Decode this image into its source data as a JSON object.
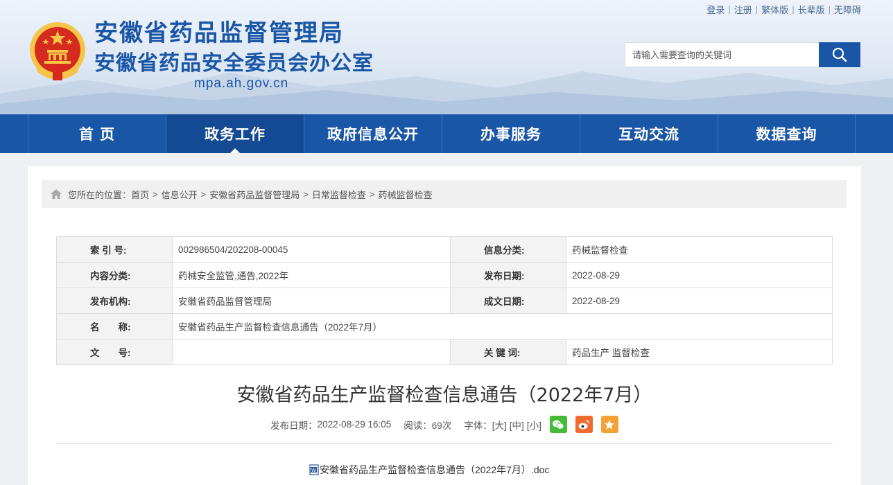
{
  "header": {
    "title": "安徽省药品监督管理局",
    "subtitle": "安徽省药品安全委员会办公室",
    "domain": "mpa.ah.gov.cn",
    "top_links": [
      "登录",
      "注册",
      "繁体版",
      "长辈版",
      "无障碍"
    ],
    "search": {
      "placeholder": "请输入需要查询的关键词",
      "icon": "search-icon"
    }
  },
  "nav": {
    "items": [
      "首 页",
      "政务工作",
      "政府信息公开",
      "办事服务",
      "互动交流",
      "数据查询"
    ],
    "active": "政务工作"
  },
  "breadcrumb": {
    "prefix": "您所在的位置：",
    "items": [
      "首页",
      "信息公开",
      "安徽省药品监督管理局",
      "日常监督检查",
      "药械监督检查"
    ],
    "separator": ">"
  },
  "meta": {
    "index_label": "索 引 号:",
    "index_value": "002986504/202208-00045",
    "info_category_label": "信息分类:",
    "info_category_value": "药械监督检查",
    "content_category_label": "内容分类:",
    "content_category_value": "药械安全监管,通告,2022年",
    "publish_date_label": "发布日期:",
    "publish_date_value": "2022-08-29",
    "publisher_label": "发布机构:",
    "publisher_value": "安徽省药品监督管理局",
    "written_date_label": "成文日期:",
    "written_date_value": "2022-08-29",
    "name_label": "名　　称:",
    "name_value": "安徽省药品生产监督检查信息通告（2022年7月）",
    "doc_no_label": "文　　号:",
    "doc_no_value": "",
    "keywords_label": "关 键 词:",
    "keywords_value": "药品生产 监督检查"
  },
  "article": {
    "title": "安徽省药品生产监督检查信息通告（2022年7月）",
    "publish_label": "发布日期：",
    "publish_value": "2022-08-29 16:05",
    "views_label": "阅读：",
    "views_value": "69次",
    "font_label": "字体：",
    "font_sizes": [
      "[大]",
      "[中]",
      "[小]"
    ],
    "share_icons": [
      "wechat-icon",
      "weibo-icon",
      "favorite-icon"
    ],
    "attachment": "安徽省药品生产监督检查信息通告（2022年7月）.doc"
  },
  "colors": {
    "primary": "#1a56a6",
    "nav_active": "#144a94",
    "wechat": "#46bb36",
    "weibo": "#ef6a2f",
    "favorite": "#f4a235"
  }
}
